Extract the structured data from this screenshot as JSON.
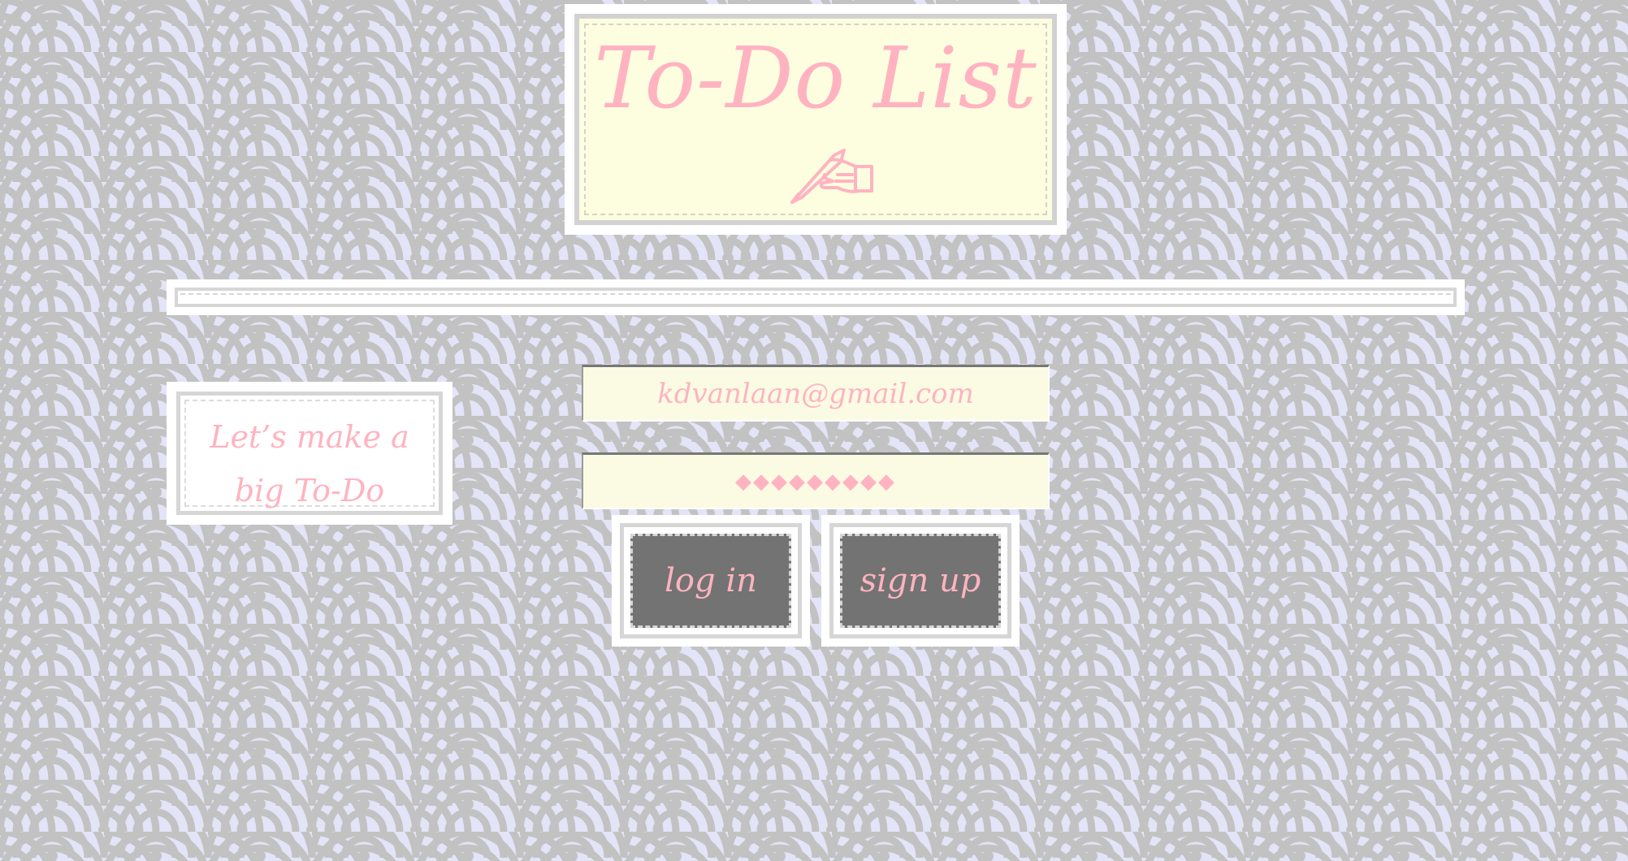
{
  "app": {
    "title": "To-Do List",
    "tagline": "Let’s make a big To-Do"
  },
  "login_form": {
    "email_value": "kdvanlaan@gmail.com",
    "password_value": "◆◆◆◆◆◆◆◆◆",
    "login_label": "log in",
    "signup_label": "sign up"
  },
  "icons": {
    "title_icon": "writing-hand-icon"
  },
  "colors": {
    "background": "#e4e4f8",
    "pattern": "#c2c2c2",
    "accent_text": "#ffb3c1",
    "card_fill": "#fdfde0",
    "button_fill": "#737373",
    "frame_border": "#d6d6d6"
  }
}
